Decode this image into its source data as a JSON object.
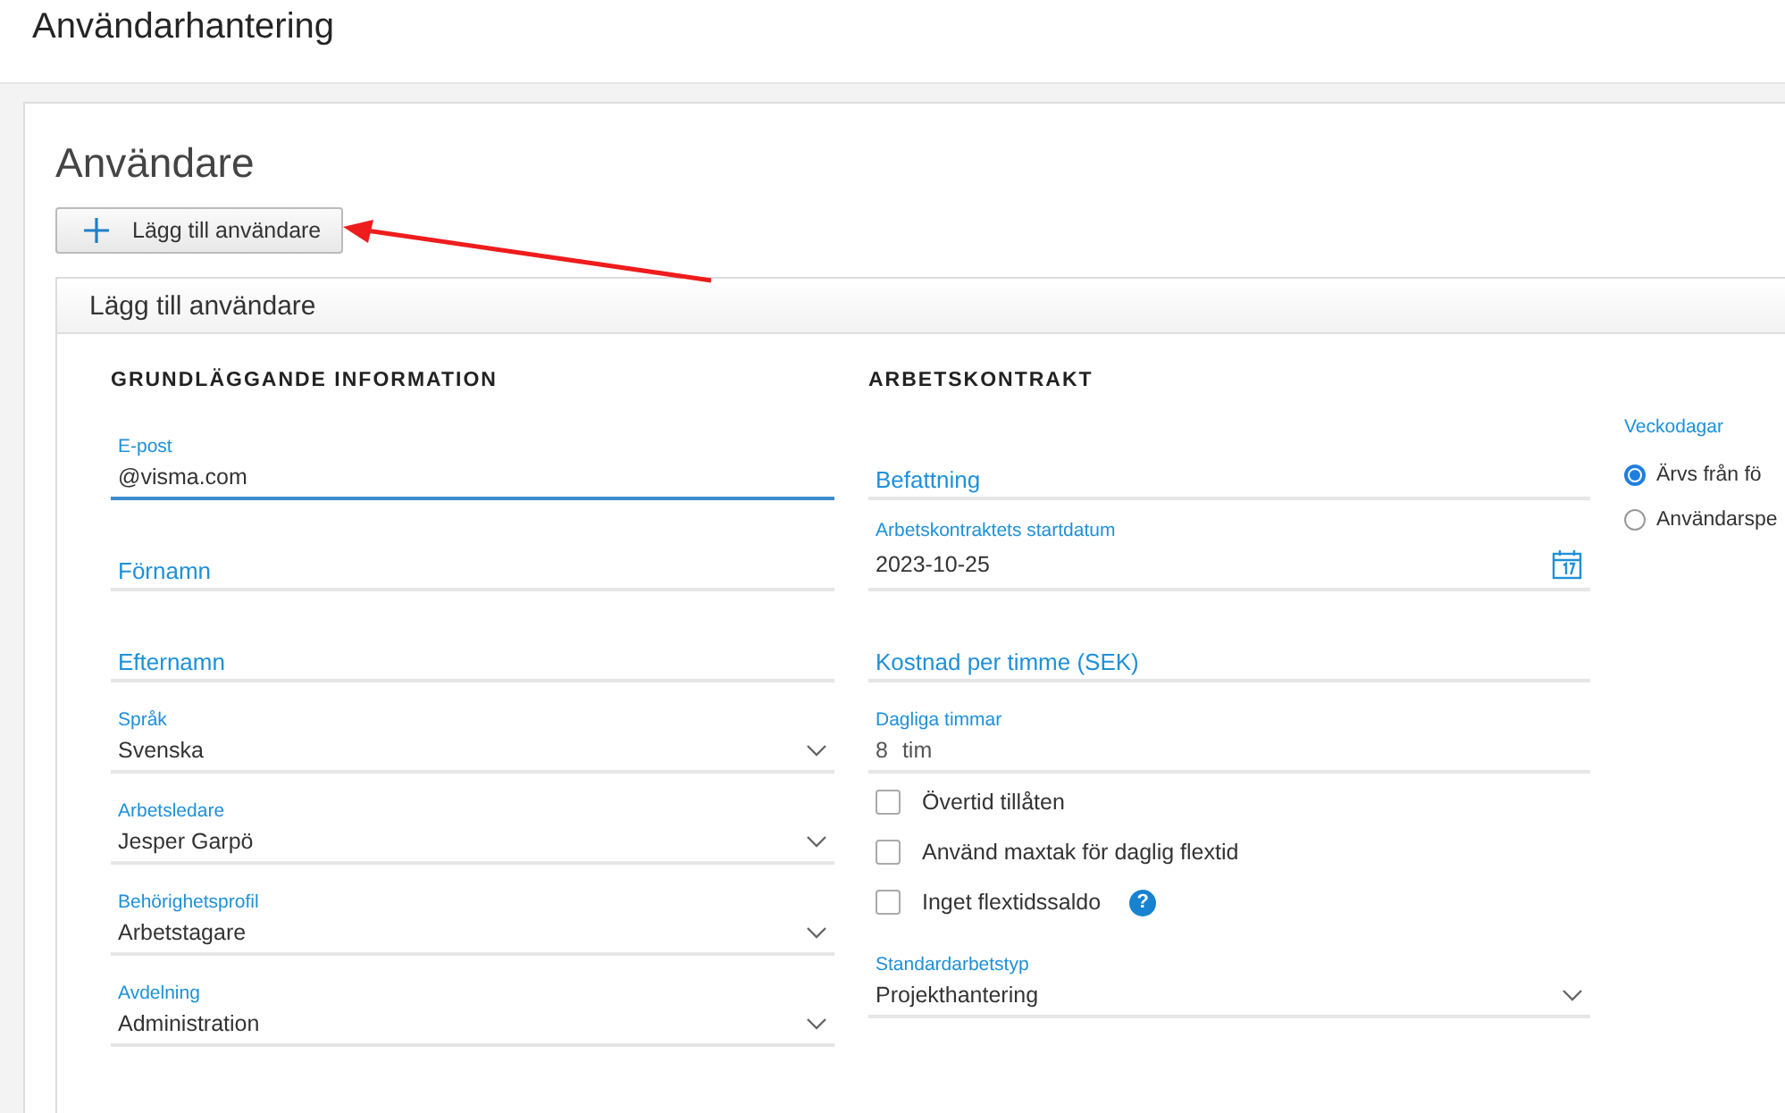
{
  "header": {
    "title": "Användarhantering"
  },
  "page": {
    "title": "Användare",
    "add_button": "Lägg till användare"
  },
  "panel": {
    "title": "Lägg till användare",
    "left": {
      "heading": "GRUNDLÄGGANDE INFORMATION",
      "fields": [
        {
          "kind": "text",
          "label": "E-post",
          "value": "@visma.com",
          "focused": true
        },
        {
          "kind": "empty",
          "placeholder": "Förnamn"
        },
        {
          "kind": "empty",
          "placeholder": "Efternamn"
        },
        {
          "kind": "select",
          "label": "Språk",
          "value": "Svenska"
        },
        {
          "kind": "select",
          "label": "Arbetsledare",
          "value": "Jesper Garpö"
        },
        {
          "kind": "select",
          "label": "Behörighetsprofil",
          "value": "Arbetstagare"
        },
        {
          "kind": "select",
          "label": "Avdelning",
          "value": "Administration"
        }
      ]
    },
    "middle": {
      "heading": "ARBETSKONTRAKT",
      "fields": [
        {
          "kind": "empty",
          "placeholder": "Befattning"
        },
        {
          "kind": "date",
          "label": "Arbetskontraktets startdatum",
          "value": "2023-10-25"
        },
        {
          "kind": "empty",
          "placeholder": "Kostnad per timme (SEK)"
        },
        {
          "kind": "unit",
          "label": "Dagliga timmar",
          "value": "8",
          "unit": "tim"
        },
        {
          "kind": "checkbox",
          "label": "Övertid tillåten",
          "checked": false
        },
        {
          "kind": "checkbox",
          "label": "Använd maxtak för daglig flextid",
          "checked": false
        },
        {
          "kind": "checkbox",
          "label": "Inget flextidssaldo",
          "checked": false,
          "help": "?"
        },
        {
          "kind": "select",
          "label": "Standardarbetstyp",
          "value": "Projekthantering"
        }
      ]
    },
    "right": {
      "label": "Veckodagar",
      "options": [
        {
          "label": "Ärvs från fö",
          "selected": true
        },
        {
          "label": "Användarspe",
          "selected": false
        }
      ]
    }
  }
}
